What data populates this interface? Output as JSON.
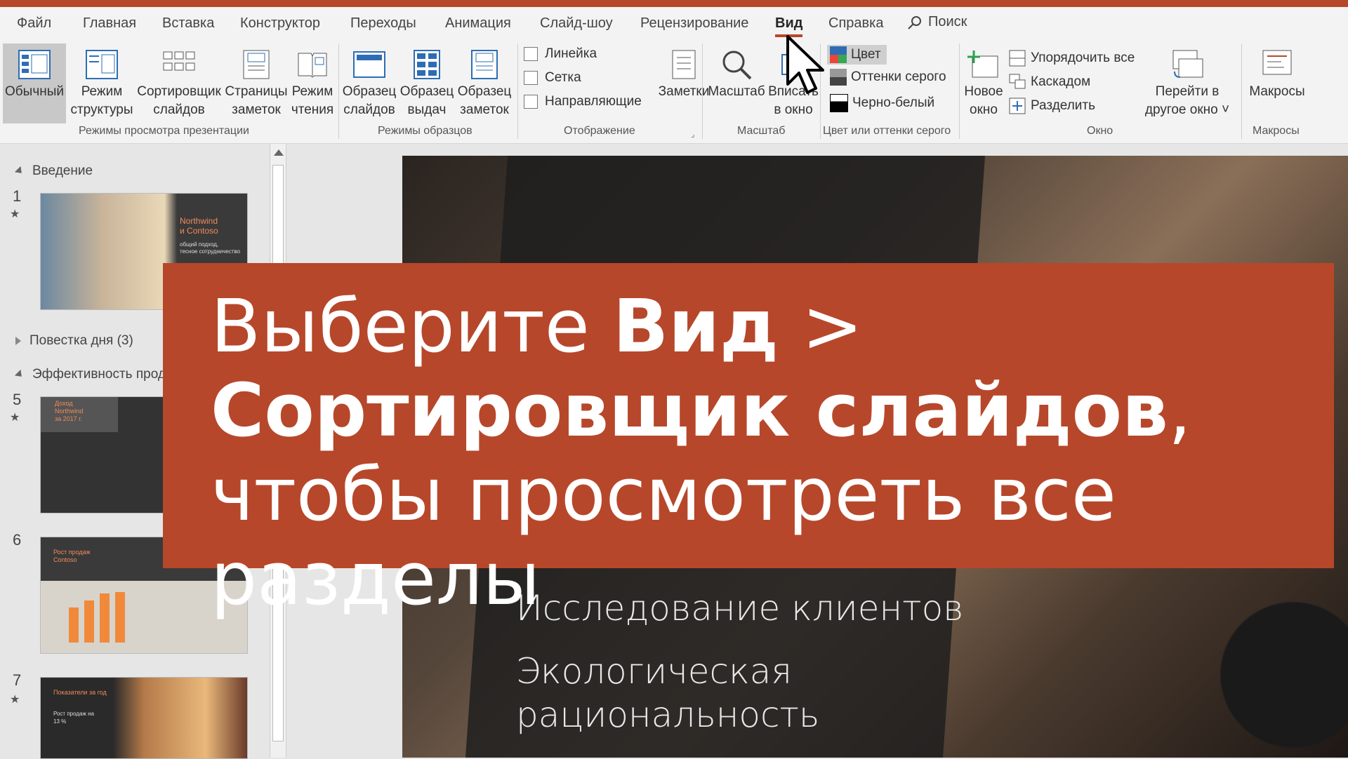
{
  "tabs": [
    "Файл",
    "Главная",
    "Вставка",
    "Конструктор",
    "Переходы",
    "Анимация",
    "Слайд-шоу",
    "Рецензирование",
    "Вид",
    "Справка"
  ],
  "active_tab": "Вид",
  "search_label": "Поиск",
  "ribbon": {
    "views": {
      "normal": "Обычный",
      "outline_1": "Режим",
      "outline_2": "структуры",
      "sorter_1": "Сортировщик",
      "sorter_2": "слайдов",
      "notes_1": "Страницы",
      "notes_2": "заметок",
      "reading_1": "Режим",
      "reading_2": "чтения",
      "group": "Режимы просмотра презентации"
    },
    "masters": {
      "slide_1": "Образец",
      "slide_2": "слайдов",
      "handout_1": "Образец",
      "handout_2": "выдач",
      "notes_1": "Образец",
      "notes_2": "заметок",
      "group": "Режимы образцов"
    },
    "show": {
      "ruler": "Линейка",
      "grid": "Сетка",
      "guides": "Направляющие",
      "group": "Отображение"
    },
    "notes": "Заметки",
    "zoom": {
      "zoom": "Масштаб",
      "fit_1": "Вписать",
      "fit_2": "в окно",
      "group": "Масштаб"
    },
    "color": {
      "color": "Цвет",
      "grayscale": "Оттенки серого",
      "bw": "Черно-белый",
      "group": "Цвет или оттенки серого"
    },
    "window": {
      "new_1": "Новое",
      "new_2": "окно",
      "arrange": "Упорядочить все",
      "cascade": "Каскадом",
      "split": "Разделить",
      "switch_1": "Перейти в",
      "switch_2": "другое окно ˅",
      "group": "Окно"
    },
    "macros": {
      "label": "Макросы",
      "group": "Макросы"
    }
  },
  "thumbnails": {
    "sections": [
      "Введение",
      "Повестка дня (3)",
      "Эффективность прода"
    ],
    "slides": [
      "1",
      "5",
      "6",
      "7"
    ],
    "slide1_title_1": "Northwind",
    "slide1_title_2": "и Contoso",
    "slide1_sub_1": "общий подход,",
    "slide1_sub_2": "тесное сотрудничество",
    "slide5_title_1": "Доход",
    "slide5_title_2": "Northwind",
    "slide5_title_3": "за 2017 г.",
    "slide6_title_1": "Рост продаж",
    "slide6_title_2": "Contoso",
    "slide7_title": "Показатели за год",
    "slide7_l1": "Рост продаж на",
    "slide7_l2": "13 %"
  },
  "slide": {
    "line1": "Исследование клиентов",
    "line2": "Экологическая",
    "line3": "рациональность"
  },
  "callout": {
    "t1": "Выберите ",
    "t2": "Вид",
    "t3": " > ",
    "t4": "Сортировщик слайдов",
    "t5": ", чтобы просмотреть все разделы"
  },
  "colors": {
    "accent": "#b7472a",
    "ribbon_bg": "#f3f3f3",
    "pane_bg": "#e6e6e6"
  }
}
